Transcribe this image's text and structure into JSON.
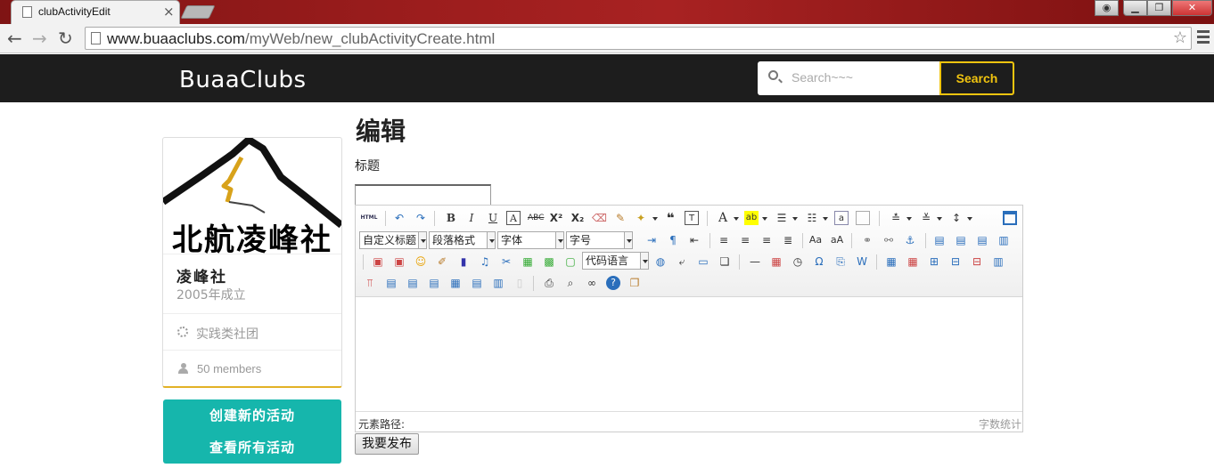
{
  "browser": {
    "tab_title": "clubActivityEdit",
    "url_host": "www.buaaclubs.com",
    "url_path": "/myWeb/new_clubActivityCreate.html"
  },
  "navbar": {
    "brand": "BuaaClubs",
    "search_placeholder": "Search~~~",
    "search_button": "Search"
  },
  "club": {
    "logo_text": "北航凌峰社",
    "name": "凌峰社",
    "founded": "2005年成立",
    "type": "实践类社团",
    "members": "50 members"
  },
  "sidebar_buttons": {
    "create": "创建新的活动",
    "view_all": "查看所有活动"
  },
  "main": {
    "page_title": "编辑",
    "title_label": "标题",
    "title_value": "",
    "publish_button": "我要发布"
  },
  "editor": {
    "html_label": "HTML",
    "dropdowns": {
      "title_style": "自定义标题",
      "paragraph": "段落格式",
      "font_family": "字体",
      "font_size": "字号",
      "code_language": "代码语言"
    },
    "element_path": "元素路径:",
    "word_count": "字数统计"
  },
  "colors": {
    "navbar_bg": "#1d1d1d",
    "accent_yellow": "#f1c40f",
    "teal_button": "#16b6ac",
    "card_bottom_border": "#e2b227"
  }
}
